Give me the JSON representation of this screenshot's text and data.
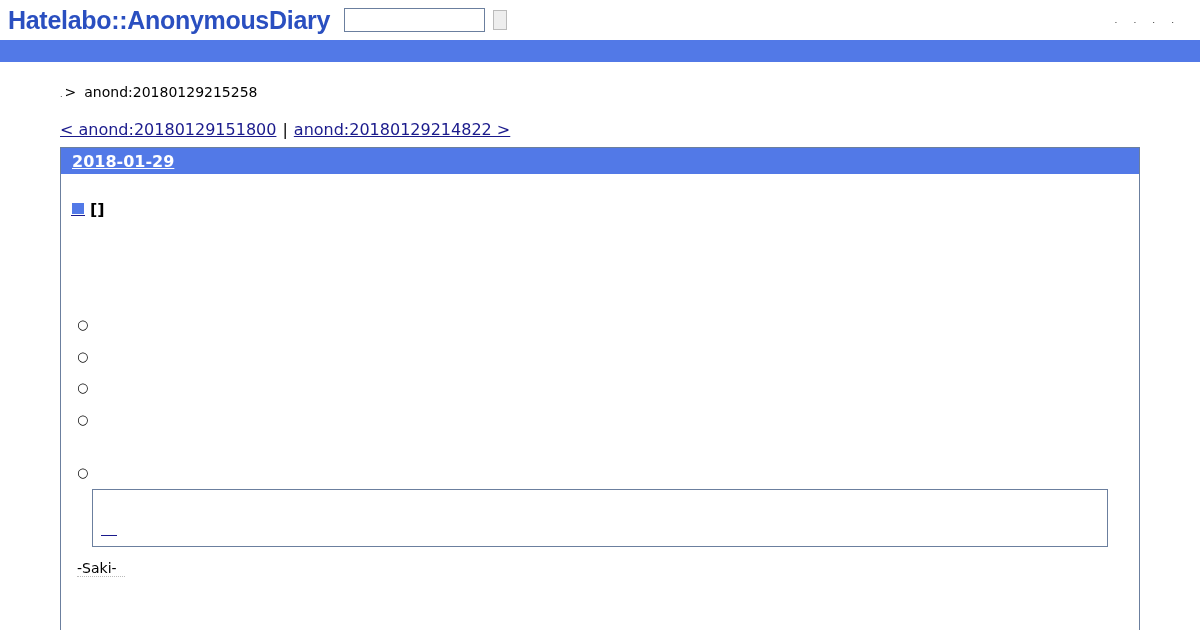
{
  "header": {
    "logo": "Hatelabo::AnonymousDiary",
    "menu": [
      ".",
      ".",
      ".",
      "."
    ]
  },
  "breadcrumb": {
    "root": ".",
    "separator": ">",
    "current": "anond:20180129215258"
  },
  "pager": {
    "prev": "< anond:20180129151800",
    "divider": "|",
    "next": "anond:20180129214822 >"
  },
  "day": {
    "date": "2018-01-29",
    "section_title": "[]",
    "list_items": [
      {
        "bullet": "○",
        "gap_before": false
      },
      {
        "bullet": "○",
        "gap_before": false
      },
      {
        "bullet": "○",
        "gap_before": false
      },
      {
        "bullet": "○",
        "gap_before": false
      },
      {
        "bullet": "○",
        "gap_before": true
      }
    ],
    "signature": "-Saki-"
  }
}
